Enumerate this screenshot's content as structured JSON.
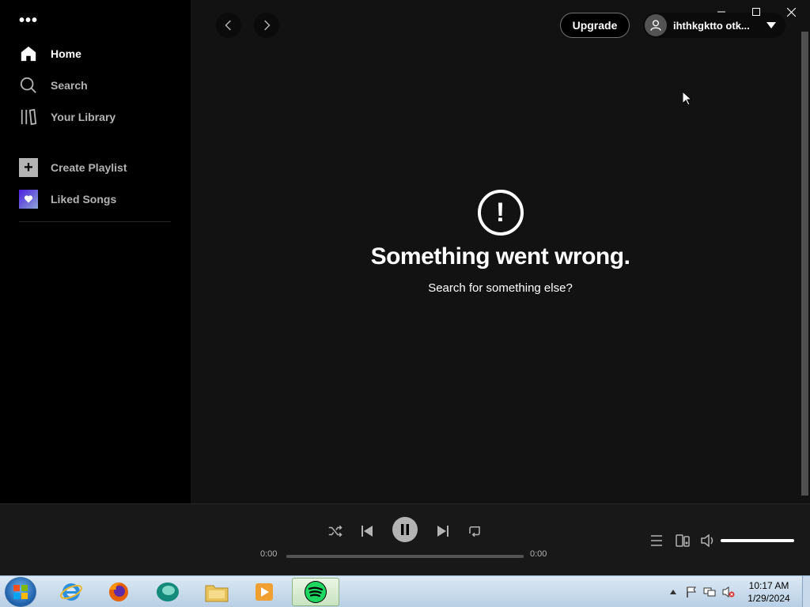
{
  "sidebar": {
    "menu_dots": "•••",
    "nav": [
      {
        "label": "Home",
        "icon": "home-icon"
      },
      {
        "label": "Search",
        "icon": "search-icon"
      },
      {
        "label": "Your Library",
        "icon": "library-icon"
      }
    ],
    "actions": [
      {
        "label": "Create Playlist",
        "icon": "plus-icon"
      },
      {
        "label": "Liked Songs",
        "icon": "heart-icon"
      }
    ]
  },
  "header": {
    "upgrade_label": "Upgrade",
    "username": "ihthkgktto otk..."
  },
  "main": {
    "error_title": "Something went wrong.",
    "error_subtitle": "Search for something else?",
    "error_icon": "!"
  },
  "player": {
    "elapsed": "0:00",
    "duration": "0:00",
    "progress_fraction": 0,
    "volume_fraction": 1.0
  },
  "taskbar": {
    "time": "10:17 AM",
    "date": "1/29/2024"
  },
  "colors": {
    "sidebar_bg": "#000000",
    "main_bg": "#121212",
    "player_bg": "#181818",
    "spotify_green": "#1ed760"
  }
}
